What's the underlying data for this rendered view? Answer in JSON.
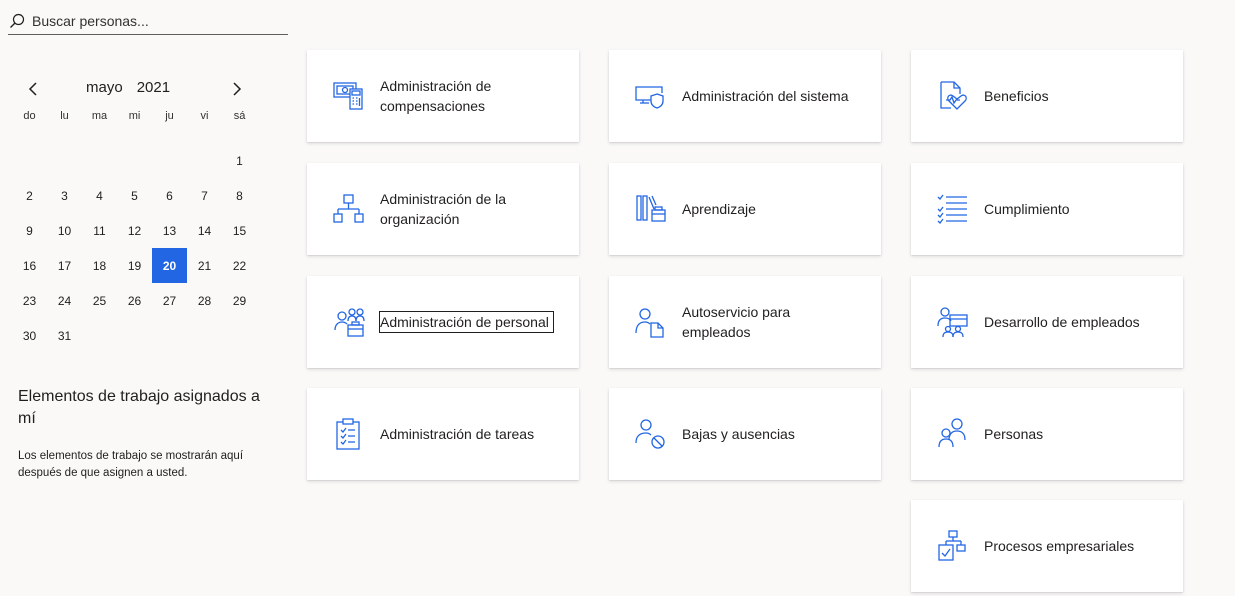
{
  "search": {
    "placeholder": "Buscar personas..."
  },
  "calendar": {
    "month": "mayo",
    "year": "2021",
    "weekdays": [
      "do",
      "lu",
      "ma",
      "mi",
      "ju",
      "vi",
      "sá"
    ],
    "weeks": [
      [
        "",
        "",
        "",
        "",
        "",
        "",
        "1"
      ],
      [
        "2",
        "3",
        "4",
        "5",
        "6",
        "7",
        "8"
      ],
      [
        "9",
        "10",
        "11",
        "12",
        "13",
        "14",
        "15"
      ],
      [
        "16",
        "17",
        "18",
        "19",
        "20",
        "21",
        "22"
      ],
      [
        "23",
        "24",
        "25",
        "26",
        "27",
        "28",
        "29"
      ],
      [
        "30",
        "31",
        "",
        "",
        "",
        "",
        ""
      ]
    ],
    "selected_day": "20"
  },
  "work_items": {
    "title": "Elementos de trabajo asignados a mí",
    "description": "Los elementos de trabajo se mostrarán aquí después de que asignen a usted."
  },
  "colors": {
    "accent": "#2266e3",
    "background": "#faf9f8",
    "tile": "#ffffff"
  },
  "tiles": [
    {
      "label": "Administración de compensaciones",
      "icon": "compensation-icon"
    },
    {
      "label": "Administración del sistema",
      "icon": "system-shield-icon"
    },
    {
      "label": "Beneficios",
      "icon": "benefits-heart-icon"
    },
    {
      "label": "Administración de la organización",
      "icon": "org-chart-icon"
    },
    {
      "label": "Aprendizaje",
      "icon": "learning-books-icon"
    },
    {
      "label": "Cumplimiento",
      "icon": "checklist-icon"
    },
    {
      "label": "Administración de personal",
      "icon": "personnel-icon"
    },
    {
      "label": "Autoservicio para empleados",
      "icon": "self-service-icon"
    },
    {
      "label": "Desarrollo de empleados",
      "icon": "employee-development-icon"
    },
    {
      "label": "Administración de tareas",
      "icon": "clipboard-tasks-icon"
    },
    {
      "label": "Bajas y ausencias",
      "icon": "leave-absence-icon"
    },
    {
      "label": "Personas",
      "icon": "people-icon"
    },
    {
      "label": "Procesos empresariales",
      "icon": "business-process-icon"
    }
  ]
}
